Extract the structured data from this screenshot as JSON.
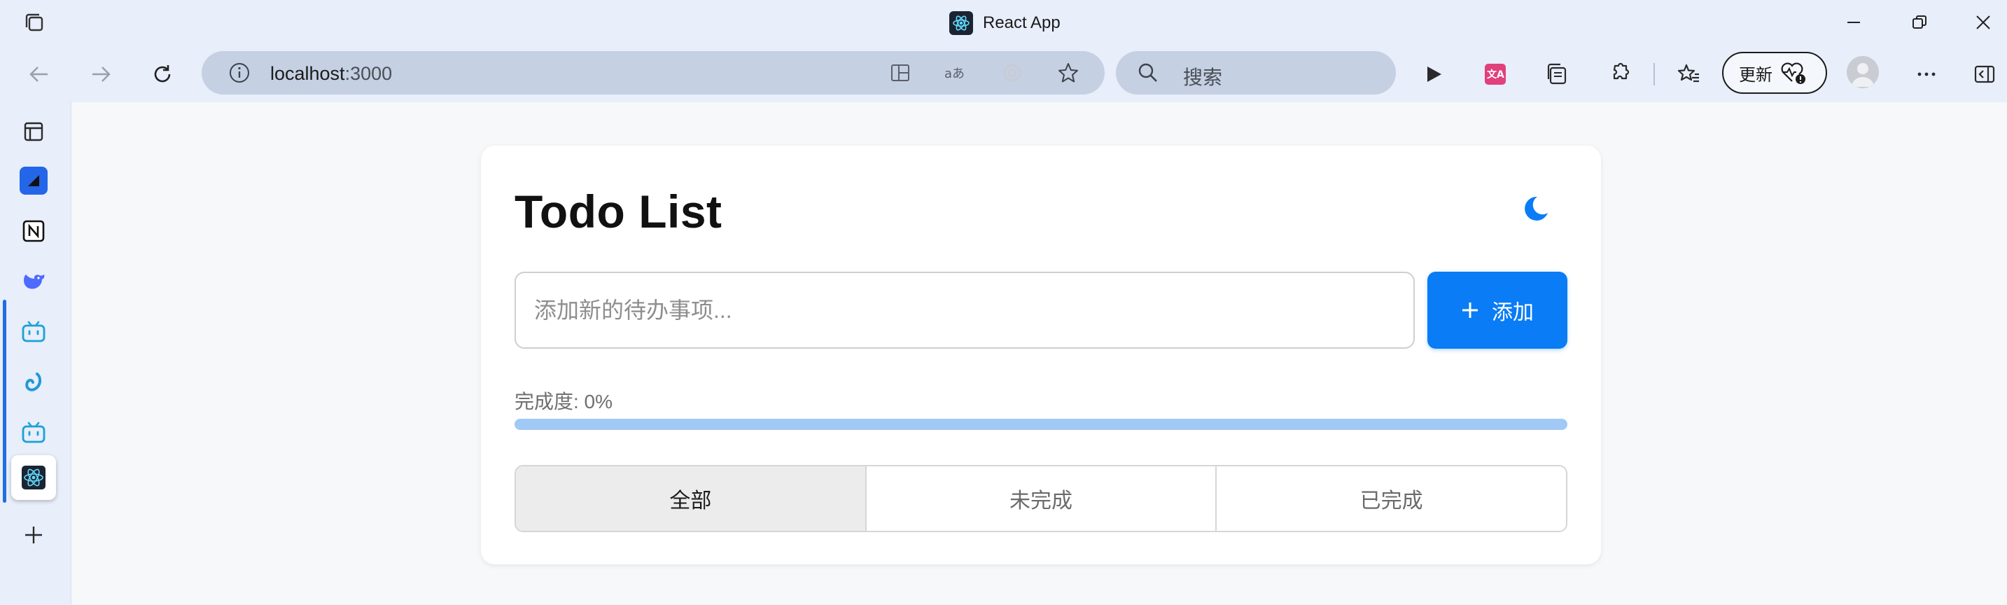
{
  "window": {
    "title": "React App"
  },
  "address_bar": {
    "host": "localhost",
    "port": ":3000"
  },
  "search_box": {
    "placeholder": "搜索"
  },
  "update_button": {
    "label": "更新"
  },
  "sidebar": {
    "items": [
      {
        "name": "tab-actions-icon"
      },
      {
        "name": "app-blue-square-icon"
      },
      {
        "name": "notion-icon"
      },
      {
        "name": "deepseek-icon"
      },
      {
        "name": "bilibili-icon"
      },
      {
        "name": "app-swirl-icon"
      },
      {
        "name": "bilibili-icon-2"
      },
      {
        "name": "react-app-icon"
      },
      {
        "name": "add-icon"
      }
    ]
  },
  "app": {
    "title": "Todo List",
    "input_placeholder": "添加新的待办事项...",
    "add_button_label": "添加",
    "progress_label": "完成度: 0%",
    "progress_value": 0,
    "filters": [
      {
        "label": "全部",
        "active": true
      },
      {
        "label": "未完成",
        "active": false
      },
      {
        "label": "已完成",
        "active": false
      }
    ]
  },
  "colors": {
    "accent": "#0a7cf5",
    "progress_track": "#a1c9f5",
    "chrome_bg": "#e8eefa",
    "address_bg": "#c5d0e3"
  }
}
